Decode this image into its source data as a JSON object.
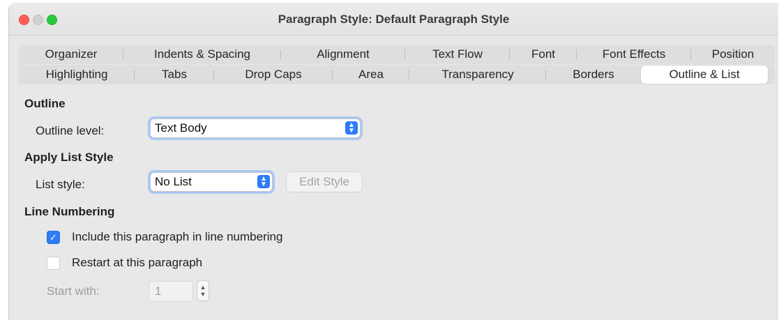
{
  "window": {
    "title": "Paragraph Style: Default Paragraph Style"
  },
  "tabs": {
    "row1": [
      "Organizer",
      "Indents & Spacing",
      "Alignment",
      "Text Flow",
      "Font",
      "Font Effects",
      "Position"
    ],
    "row2": [
      "Highlighting",
      "Tabs",
      "Drop Caps",
      "Area",
      "Transparency",
      "Borders",
      "Outline & List"
    ],
    "active": "Outline & List"
  },
  "outline": {
    "heading": "Outline",
    "level_label": "Outline level:",
    "level_value": "Text Body"
  },
  "list_style": {
    "heading": "Apply List Style",
    "label": "List style:",
    "value": "No List",
    "edit_button": "Edit Style"
  },
  "line_numbering": {
    "heading": "Line Numbering",
    "include_label": "Include this paragraph in line numbering",
    "include_checked": true,
    "restart_label": "Restart at this paragraph",
    "restart_checked": false,
    "start_label": "Start with:",
    "start_value": "1"
  },
  "colors": {
    "accent": "#2e7cf6",
    "close": "#fe5f57",
    "maximize": "#2ac940"
  }
}
